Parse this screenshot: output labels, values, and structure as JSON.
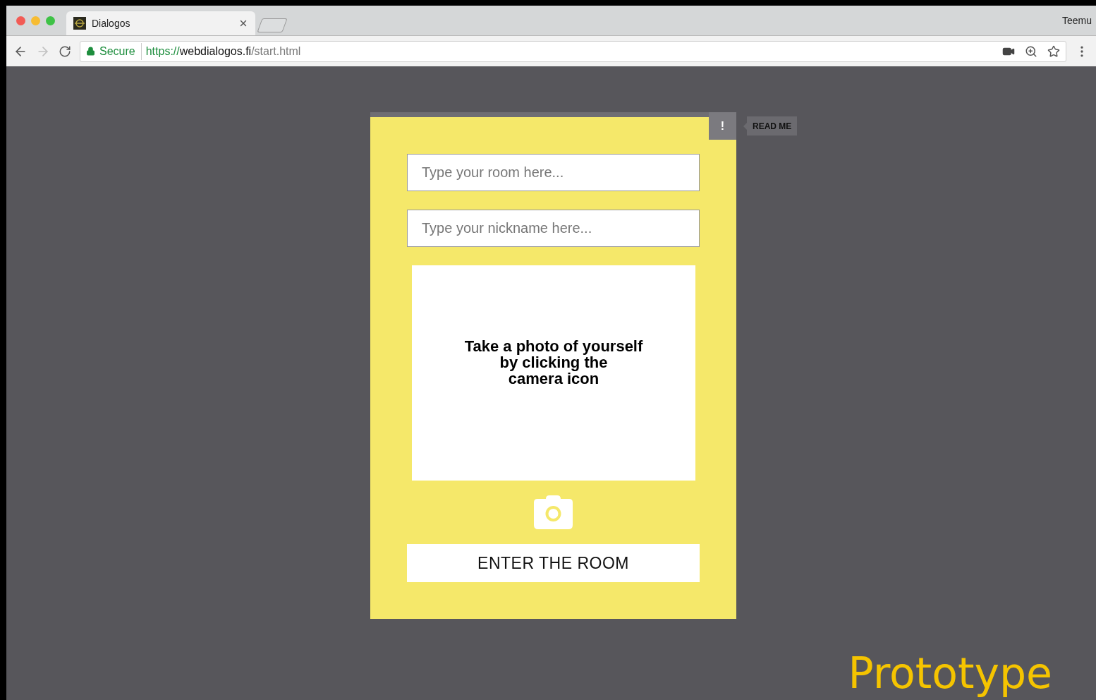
{
  "browser": {
    "tab": {
      "title": "Dialogos",
      "selected": true
    },
    "profile": "Teemu",
    "address": {
      "secure_label": "Secure",
      "url_scheme": "https://",
      "url_host": "webdialogos.fi",
      "url_path": "/start.html"
    }
  },
  "page": {
    "info_button": "!",
    "tooltip": "READ ME",
    "fields": [
      {
        "placeholder": "Type your room here..."
      },
      {
        "placeholder": "Type your nickname here..."
      }
    ],
    "photo_prompt": [
      "Take a photo of yourself",
      "by clicking the",
      "camera icon"
    ],
    "enter_button": "ENTER THE ROOM"
  },
  "caption": "Prototype"
}
